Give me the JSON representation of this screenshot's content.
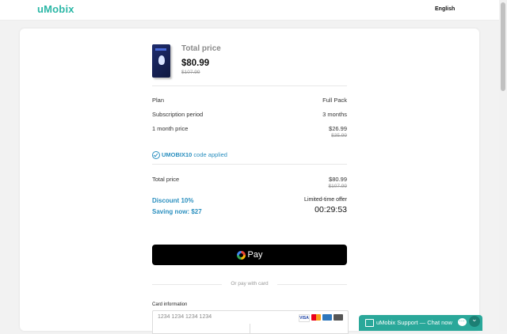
{
  "header": {
    "logo": "uMobix",
    "language": "English"
  },
  "summary": {
    "heading": "Total price",
    "price": "$80.99",
    "old_price": "$107.99"
  },
  "details": [
    {
      "label": "Plan",
      "value": "Full Pack"
    },
    {
      "label": "Subscription period",
      "value": "3 months"
    },
    {
      "label": "1 month price",
      "value": "$26.99",
      "old_value": "$35.99"
    }
  ],
  "promo": {
    "code": "UMOBIX10",
    "suffix": " code applied"
  },
  "total": {
    "label": "Total price",
    "value": "$80.99",
    "old_value": "$107.99"
  },
  "discount": {
    "discount_label": "Discount 10%",
    "saving_label": "Saving now: $27",
    "offer_label": "Limited-time offer",
    "timer": "00:29:53"
  },
  "payment": {
    "gpay_label": "Pay",
    "divider_text": "Or pay with card",
    "card_label": "Card information",
    "card_placeholder": "1234 1234 1234 1234",
    "brands": [
      "visa",
      "mastercard",
      "amex",
      "generic"
    ]
  },
  "chat": {
    "label": "uMobix Support — Chat now"
  },
  "colors": {
    "brand": "#2bb7a6",
    "accent": "#2a8fbf",
    "chat": "#2aa89a"
  }
}
